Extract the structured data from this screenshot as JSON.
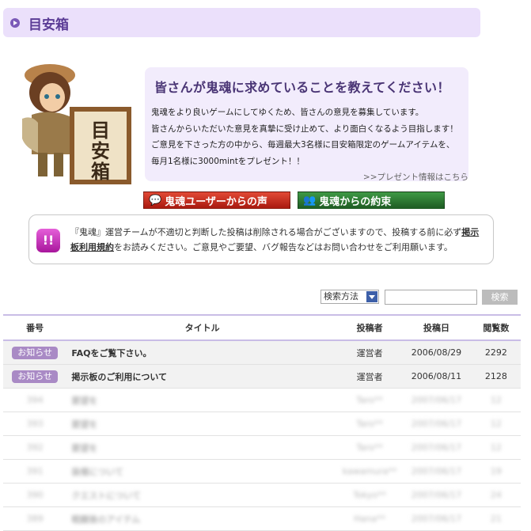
{
  "header": {
    "title": "目安箱"
  },
  "banner": {
    "headline": "皆さんが鬼魂に求めていることを教えてください！",
    "lines": [
      "鬼魂をより良いゲームにしてゆくため、皆さんの意見を募集しています。",
      "皆さんからいただいた意見を真摯に受け止めて、より面白くなるよう目指します！",
      "ご意見を下さった方の中から、毎週最大3名様に目安箱限定のゲームアイテムを、",
      "毎月1名様に3000mintをプレゼント！！"
    ],
    "present_link": ">>プレゼント情報はこちら",
    "sign_text": "目安箱"
  },
  "tabs": {
    "voices": "鬼魂ユーザーからの声",
    "promise": "鬼魂からの約束"
  },
  "notice": {
    "icon": "!!",
    "pre": "『鬼魂』運営チームが不適切と判断した投稿は削除される場合がございますので、投稿する前に必ず",
    "link": "掲示板利用規約",
    "post": "をお読みください。ご意見やご要望、バグ報告などはお問い合わせをご利用願います。"
  },
  "search": {
    "method": "検索方法",
    "button": "検索"
  },
  "table": {
    "headers": [
      "番号",
      "タイトル",
      "投稿者",
      "投稿日",
      "閲覧数"
    ],
    "pinned": [
      {
        "badge": "お知らせ",
        "title": "FAQをご覧下さい。",
        "author": "運営者",
        "date": "2006/08/29",
        "views": "2292"
      },
      {
        "badge": "お知らせ",
        "title": "掲示板のご利用について",
        "author": "運営者",
        "date": "2006/08/11",
        "views": "2128"
      }
    ],
    "blurred": [
      {
        "no": "394",
        "title": "要望を",
        "author": "Taro**",
        "date": "2007/06/17",
        "views": "12"
      },
      {
        "no": "393",
        "title": "要望を",
        "author": "Taro**",
        "date": "2007/06/17",
        "views": "12"
      },
      {
        "no": "392",
        "title": "要望を",
        "author": "Taro**",
        "date": "2007/06/17",
        "views": "12"
      },
      {
        "no": "391",
        "title": "装備について",
        "author": "kawamura**",
        "date": "2007/06/17",
        "views": "19"
      },
      {
        "no": "390",
        "title": "クエストについて",
        "author": "Tokyo**",
        "date": "2007/06/17",
        "views": "24"
      },
      {
        "no": "389",
        "title": "戦闘後のアイテム",
        "author": "Hana**",
        "date": "2007/06/17",
        "views": "21"
      }
    ]
  },
  "colors": {
    "accent": "#5b3c96",
    "header_bg": "#ebe0fb",
    "badge": "#a98ac5"
  }
}
